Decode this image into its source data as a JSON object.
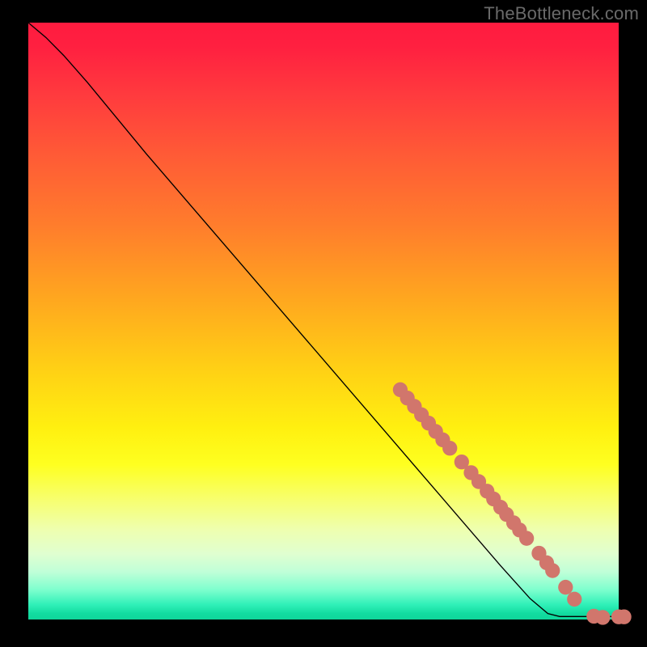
{
  "watermark": "TheBottleneck.com",
  "chart_data": {
    "type": "line",
    "title": "",
    "xlabel": "",
    "ylabel": "",
    "xlim": [
      0,
      100
    ],
    "ylim": [
      0,
      100
    ],
    "curve": [
      {
        "x": 0,
        "y": 100
      },
      {
        "x": 3,
        "y": 97.5
      },
      {
        "x": 6,
        "y": 94.5
      },
      {
        "x": 10,
        "y": 90
      },
      {
        "x": 20,
        "y": 78
      },
      {
        "x": 30,
        "y": 66.5
      },
      {
        "x": 40,
        "y": 55
      },
      {
        "x": 50,
        "y": 43.5
      },
      {
        "x": 60,
        "y": 32
      },
      {
        "x": 70,
        "y": 20.5
      },
      {
        "x": 80,
        "y": 9
      },
      {
        "x": 85,
        "y": 3.5
      },
      {
        "x": 88,
        "y": 1
      },
      {
        "x": 90,
        "y": 0.5
      },
      {
        "x": 95,
        "y": 0.5
      },
      {
        "x": 100,
        "y": 0.5
      }
    ],
    "marker_color": "#d1766c",
    "markers": [
      {
        "x": 63,
        "y": 38.5
      },
      {
        "x": 64.2,
        "y": 37.1
      },
      {
        "x": 65.4,
        "y": 35.7
      },
      {
        "x": 66.6,
        "y": 34.3
      },
      {
        "x": 67.8,
        "y": 32.9
      },
      {
        "x": 69,
        "y": 31.5
      },
      {
        "x": 70.2,
        "y": 30.1
      },
      {
        "x": 71.4,
        "y": 28.7
      },
      {
        "x": 73.4,
        "y": 26.4
      },
      {
        "x": 75,
        "y": 24.6
      },
      {
        "x": 76.3,
        "y": 23.1
      },
      {
        "x": 77.7,
        "y": 21.5
      },
      {
        "x": 78.8,
        "y": 20.2
      },
      {
        "x": 80,
        "y": 18.8
      },
      {
        "x": 81,
        "y": 17.6
      },
      {
        "x": 82.2,
        "y": 16.2
      },
      {
        "x": 83.2,
        "y": 15.0
      },
      {
        "x": 84.4,
        "y": 13.6
      },
      {
        "x": 86.5,
        "y": 11.1
      },
      {
        "x": 87.8,
        "y": 9.5
      },
      {
        "x": 88.8,
        "y": 8.2
      },
      {
        "x": 91,
        "y": 5.4
      },
      {
        "x": 92.5,
        "y": 3.4
      },
      {
        "x": 95.8,
        "y": 0.55
      },
      {
        "x": 97.3,
        "y": 0.35
      },
      {
        "x": 100,
        "y": 0.45
      },
      {
        "x": 100.9,
        "y": 0.45
      }
    ]
  }
}
